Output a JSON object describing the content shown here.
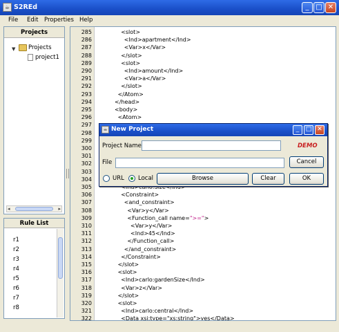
{
  "window": {
    "title": "S2REd"
  },
  "menu": [
    "File",
    "Edit",
    "Properties",
    "Help"
  ],
  "projects_panel": {
    "header": "Projects",
    "root": "Projects",
    "children": [
      "project1"
    ]
  },
  "rule_list": {
    "header": "Rule List",
    "items": [
      "r1",
      "r2",
      "r3",
      "r4",
      "r5",
      "r6",
      "r7",
      "r8"
    ]
  },
  "editor": {
    "lines": [
      {
        "n": "285",
        "indent": 2,
        "text": "<slot>"
      },
      {
        "n": "286",
        "indent": 3,
        "text": "<Ind>apartment</Ind>"
      },
      {
        "n": "287",
        "indent": 3,
        "text": "<Var>x</Var>"
      },
      {
        "n": "288",
        "indent": 2,
        "text": "</slot>"
      },
      {
        "n": "289",
        "indent": 2,
        "text": "<slot>"
      },
      {
        "n": "290",
        "indent": 3,
        "text": "<Ind>amount</Ind>"
      },
      {
        "n": "291",
        "indent": 3,
        "text": "<Var>a</Var>"
      },
      {
        "n": "292",
        "indent": 2,
        "text": "</slot>"
      },
      {
        "n": "293",
        "indent": 1,
        "text": "</Atom>"
      },
      {
        "n": "294",
        "indent": 0,
        "text": "</head>"
      },
      {
        "n": "295",
        "indent": 0,
        "text": "<body>"
      },
      {
        "n": "296",
        "indent": 1,
        "text": "<Atom>"
      },
      {
        "n": "297",
        "indent": 0,
        "text": ""
      },
      {
        "n": "298",
        "indent": 0,
        "text": ""
      },
      {
        "n": "299",
        "indent": 0,
        "text": ""
      },
      {
        "n": "300",
        "indent": 0,
        "text": ""
      },
      {
        "n": "301",
        "indent": 0,
        "text": ""
      },
      {
        "n": "302",
        "indent": 0,
        "text": ""
      },
      {
        "n": "303",
        "indent": 0,
        "text": ""
      },
      {
        "n": "304",
        "indent": 0,
        "text": ""
      },
      {
        "n": "305",
        "indent": 2,
        "text": "<Ind>carlo:Size</Ind>"
      },
      {
        "n": "306",
        "indent": 2,
        "text": "<Constraint>"
      },
      {
        "n": "307",
        "indent": 3,
        "text": "<and_constraint>"
      },
      {
        "n": "308",
        "indent": 4,
        "text": "<Var>y</Var>"
      },
      {
        "n": "309",
        "indent": 4,
        "text": "<Function_call name=",
        "attr": "\">=\"",
        "tail": ">"
      },
      {
        "n": "310",
        "indent": 5,
        "text": "<Var>y</Var>"
      },
      {
        "n": "311",
        "indent": 5,
        "text": "<Ind>45</Ind>"
      },
      {
        "n": "312",
        "indent": 4,
        "text": "</Function_call>"
      },
      {
        "n": "313",
        "indent": 3,
        "text": "</and_constraint>"
      },
      {
        "n": "314",
        "indent": 2,
        "text": "</Constraint>"
      },
      {
        "n": "315",
        "indent": 1,
        "text": "</slot>"
      },
      {
        "n": "316",
        "indent": 1,
        "text": "<slot>"
      },
      {
        "n": "317",
        "indent": 2,
        "text": "<Ind>carlo:gardenSize</Ind>"
      },
      {
        "n": "318",
        "indent": 2,
        "text": "<Var>z</Var>"
      },
      {
        "n": "319",
        "indent": 1,
        "text": "</slot>"
      },
      {
        "n": "320",
        "indent": 1,
        "text": "<slot>"
      },
      {
        "n": "321",
        "indent": 2,
        "text": "<Ind>carlo:central</Ind>"
      },
      {
        "n": "322",
        "indent": 2,
        "text": "<Data xsi:type=\"xs:string\">yes</Data>"
      }
    ]
  },
  "dialog": {
    "title": "New Project",
    "project_name_label": "Project Name",
    "project_name_value": "",
    "demo_label": "DEMO",
    "file_label": "File",
    "file_value": "",
    "cancel_label": "Cancel",
    "url_label": "URL",
    "local_label": "Local",
    "source_selected": "Local",
    "browse_label": "Browse",
    "clear_label": "Clear",
    "ok_label": "OK"
  }
}
